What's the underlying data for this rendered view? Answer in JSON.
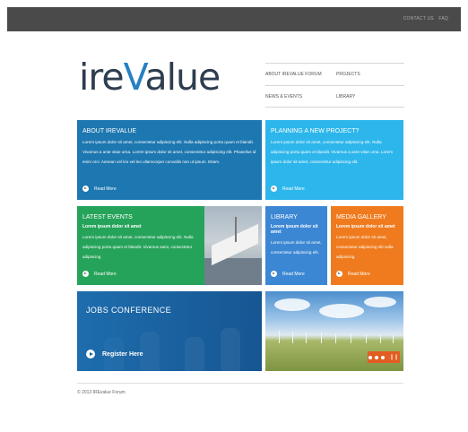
{
  "topbar": {
    "links": [
      "CONTACT US",
      "FAQ"
    ]
  },
  "logo": {
    "part1": "ire",
    "part2": "V",
    "part3": "alue"
  },
  "nav": {
    "row1": [
      "ABOUT IREVALUE FORUM",
      "PROJECTS"
    ],
    "row2": [
      "NEWS & EVENTS",
      "LIBRARY"
    ]
  },
  "tiles": {
    "about": {
      "title": "ABOUT IREVALUE",
      "text": "Lorem ipsum dolor sit amet, consectetur adipiscing elit. Nulla adipiscing porta quam et blandit. Vivamus a ante vitae urna. Lorem ipsum dolor sit amet, consectetur adipiscing elit. Phasellus id enim orci. Aenean vel leo vel leo ullamcorper convallis non ut ipsum. Etiam.",
      "readmore": "Read More",
      "color": "#1d77b0"
    },
    "planning": {
      "title": "PLANNING A NEW PROJECT?",
      "text": "Lorem ipsum dolor sit amet, consectetur adipiscing elit. Nulla adipiscing porta quam et blandit. Vivamus a ante vitae urna. Lorem ipsum dolor sit amet, consectetur adipiscing elit.",
      "readmore": "Read More",
      "color": "#2db6eb"
    },
    "events": {
      "title": "LATEST EVENTS",
      "bold": "Lorem ipsum dolor sit amet",
      "text": "Lorem ipsum dolor sit amet, consectetur adipiscing elit. Nulla adipiscing porta quam et blandit. Vivamus sami, consectetur adipiscing",
      "readmore": "Read More",
      "color": "#26a35a"
    },
    "library": {
      "title": "LIBRARY",
      "bold": "Lorem ipsum dolor sit amet",
      "text": "Lorem ipsum dolor sit amet, consectetur adipiscing elit.",
      "readmore": "Read More",
      "color": "#3c87d3"
    },
    "media": {
      "title": "MEDIA GALLERY",
      "bold": "Lorem ipsum dolor sit amet",
      "text": "Lorem ipsum dolor sit amet, consectetur adipiscing elit nulla adipiscing",
      "readmore": "Read More",
      "color": "#ef7b1e"
    },
    "jobs": {
      "title": "JOBS CONFERENCE",
      "register": "Register Here"
    }
  },
  "slider": {
    "pause_icon": "pause-icon"
  },
  "footer": {
    "copyright": "© 2013 IREvalue Forum"
  }
}
